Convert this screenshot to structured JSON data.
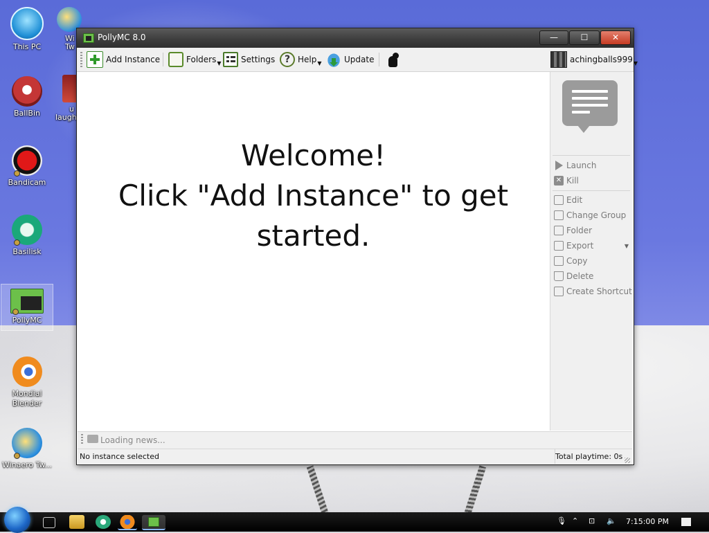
{
  "desktop": {
    "icons": [
      {
        "label": "This PC"
      },
      {
        "label": "BallBin"
      },
      {
        "label": "Bandicam"
      },
      {
        "label": "Basilisk"
      },
      {
        "label": "PollyMC"
      },
      {
        "label": "Mondial Blender"
      },
      {
        "label": "Winaero Tw..."
      }
    ],
    "partial_labels": [
      "Wi",
      "Tw",
      "u",
      "laugh"
    ]
  },
  "window": {
    "title": "PollyMC 8.0",
    "minimize": "—",
    "maximize": "☐",
    "close": "✕"
  },
  "toolbar": {
    "add_instance": "Add Instance",
    "folders": "Folders",
    "settings": "Settings",
    "help": "Help",
    "update": "Update",
    "account": "achingballs999"
  },
  "main": {
    "welcome_line1": "Welcome!",
    "welcome_line2": "Click \"Add Instance\" to get started."
  },
  "sidebar": {
    "items": [
      {
        "label": "Launch"
      },
      {
        "label": "Kill"
      },
      {
        "label": "Edit"
      },
      {
        "label": "Change Group"
      },
      {
        "label": "Folder"
      },
      {
        "label": "Export"
      },
      {
        "label": "Copy"
      },
      {
        "label": "Delete"
      },
      {
        "label": "Create Shortcut"
      }
    ]
  },
  "news": {
    "text": "Loading news..."
  },
  "status": {
    "selection": "No instance selected",
    "playtime": "Total playtime: 0s"
  },
  "taskbar": {
    "clock": "7:15:00 PM"
  },
  "colors": {
    "accent_green": "#6cc04a",
    "close_red": "#c53a22"
  }
}
